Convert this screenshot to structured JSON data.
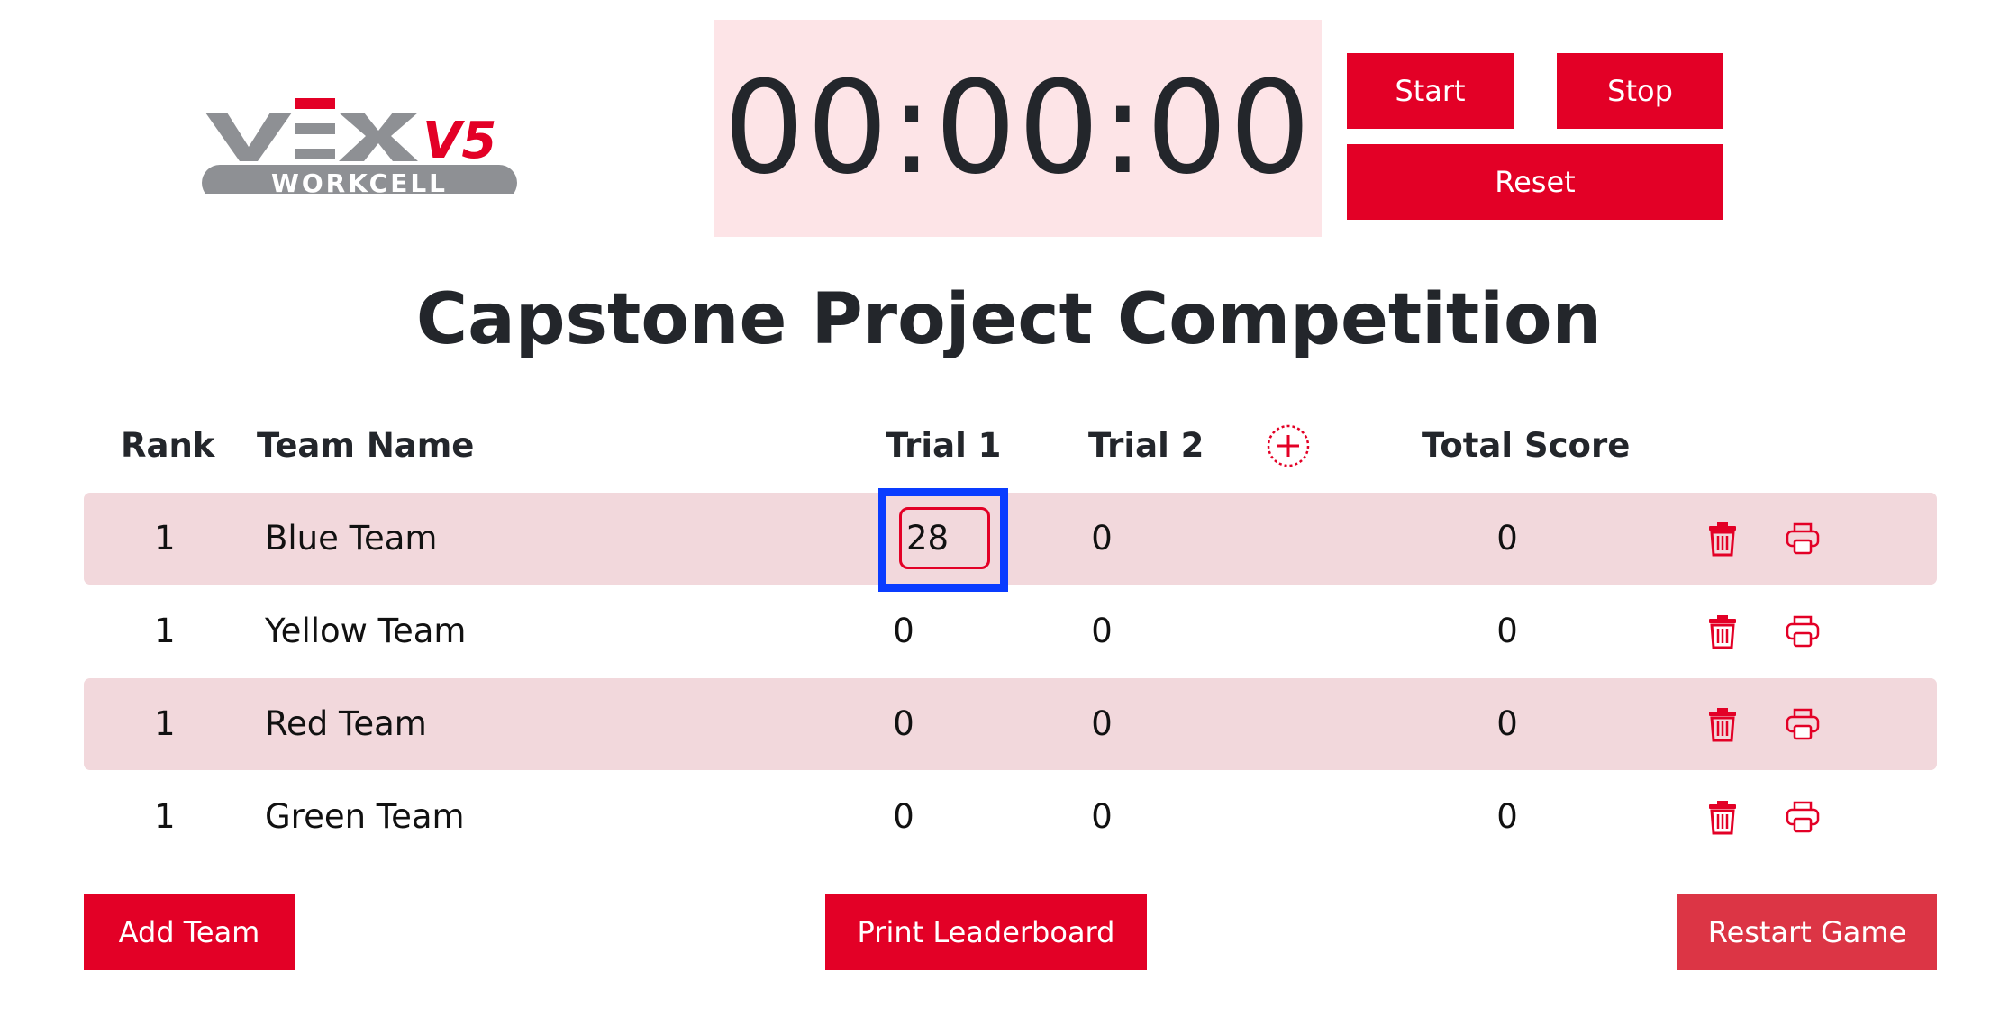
{
  "logo": {
    "brand": "VEX",
    "version": "V5",
    "product": "WORKCELL"
  },
  "timer": {
    "display": "00:00:00"
  },
  "controls": {
    "start_label": "Start",
    "stop_label": "Stop",
    "reset_label": "Reset"
  },
  "page_title": "Capstone Project Competition",
  "table": {
    "headers": {
      "rank": "Rank",
      "team_name": "Team Name",
      "trial1": "Trial 1",
      "trial2": "Trial 2",
      "total": "Total Score"
    },
    "rows": [
      {
        "rank": "1",
        "team": "Blue Team",
        "trial1": "28",
        "trial2": "0",
        "total": "0"
      },
      {
        "rank": "1",
        "team": "Yellow Team",
        "trial1": "0",
        "trial2": "0",
        "total": "0"
      },
      {
        "rank": "1",
        "team": "Red Team",
        "trial1": "0",
        "trial2": "0",
        "total": "0"
      },
      {
        "rank": "1",
        "team": "Green Team",
        "trial1": "0",
        "trial2": "0",
        "total": "0"
      }
    ]
  },
  "footer": {
    "add_team_label": "Add Team",
    "print_leaderboard_label": "Print Leaderboard",
    "restart_game_label": "Restart Game"
  },
  "colors": {
    "accent": "#e30026",
    "timer_bg": "#fde4e7",
    "row_shade": "#f2d8dc",
    "focus_outline": "#0a3cff",
    "logo_gray": "#8e9094"
  },
  "icons": {
    "add_column": "plus-circle-icon",
    "delete": "trash-icon",
    "print": "printer-icon"
  }
}
